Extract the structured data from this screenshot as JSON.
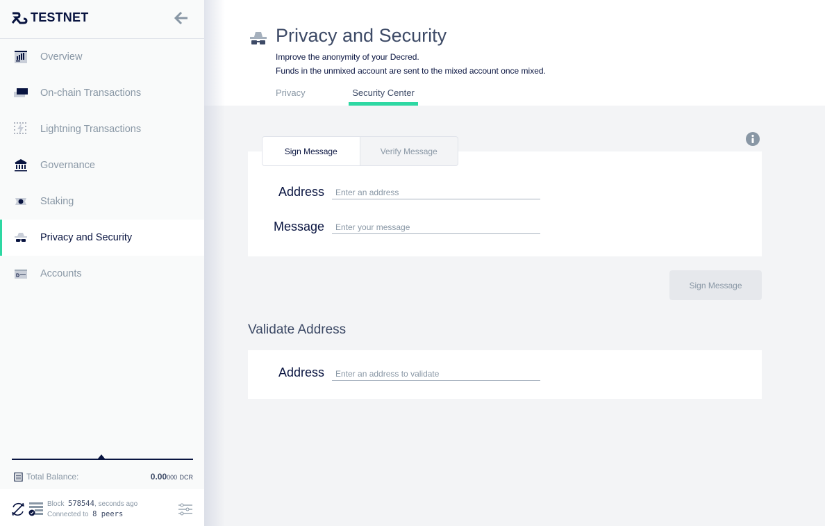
{
  "app": {
    "network_label": "TESTNET"
  },
  "sidebar": {
    "items": [
      {
        "label": "Overview",
        "icon": "overview-icon",
        "active": false
      },
      {
        "label": "On-chain Transactions",
        "icon": "transactions-icon",
        "active": false
      },
      {
        "label": "Lightning Transactions",
        "icon": "lightning-icon",
        "active": false
      },
      {
        "label": "Governance",
        "icon": "governance-icon",
        "active": false
      },
      {
        "label": "Staking",
        "icon": "staking-icon",
        "active": false
      },
      {
        "label": "Privacy and Security",
        "icon": "privacy-icon",
        "active": true
      },
      {
        "label": "Accounts",
        "icon": "accounts-icon",
        "active": false
      }
    ],
    "total_balance_label": "Total Balance:",
    "total_balance_main": "0.00",
    "total_balance_fraction": "000",
    "total_balance_unit": "DCR",
    "status": {
      "block_label": "Block",
      "block_number": "578544",
      "block_time": ", seconds ago",
      "connected_label": "Connected to",
      "peers": "8 peers"
    }
  },
  "header": {
    "title": "Privacy and Security",
    "description_line1": "Improve the anonymity of your Decred.",
    "description_line2": "Funds in the unmixed account are sent to the mixed account once mixed.",
    "tabs": [
      {
        "label": "Privacy",
        "active": false
      },
      {
        "label": "Security Center",
        "active": true
      }
    ]
  },
  "accent_color": "#2ed8a3",
  "security_center": {
    "segments": [
      {
        "label": "Sign Message",
        "active": true
      },
      {
        "label": "Verify Message",
        "active": false
      }
    ],
    "sign_form": {
      "address_label": "Address",
      "address_placeholder": "Enter an address",
      "address_value": "",
      "message_label": "Message",
      "message_placeholder": "Enter your message",
      "message_value": "",
      "submit_label": "Sign Message"
    },
    "validate": {
      "title": "Validate Address",
      "address_label": "Address",
      "address_placeholder": "Enter an address to validate",
      "address_value": ""
    }
  }
}
